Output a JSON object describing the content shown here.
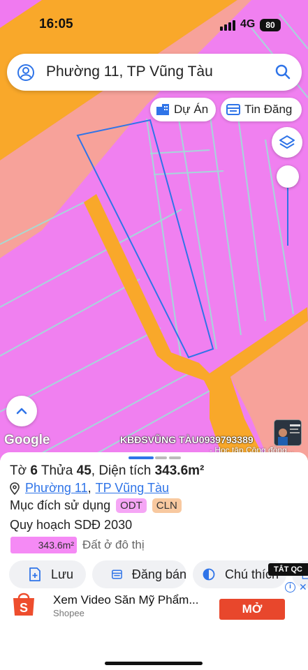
{
  "status_bar": {
    "time": "16:05",
    "network": "4G",
    "battery": "80"
  },
  "search": {
    "text": "Phường 11, TP Vũng Tàu"
  },
  "chips": {
    "du_an": "Dự Án",
    "tin_dang": "Tin Đăng"
  },
  "map": {
    "attribution": "Google",
    "watermark": "KBĐSVŨNG TÀU0939793389",
    "watermark_sub": "- Học tập Cộng đồng..."
  },
  "parcel": {
    "to_label": "Tờ",
    "to_value": "6",
    "thua_label": "Thửa",
    "thua_value": "45",
    "area_label": "Diện tích",
    "area_value": "343.6m²",
    "ward": "Phường 11",
    "city": "TP Vũng Tàu",
    "use_label": "Mục đích sử dụng",
    "use_codes": [
      "ODT",
      "CLN"
    ],
    "plan_label": "Quy hoạch SDĐ 2030",
    "plan_area": "343.6m²",
    "plan_desc": "Đất ở đô thị"
  },
  "actions": {
    "save": "Lưu",
    "post_sale": "Đăng bán",
    "legend": "Chú thích"
  },
  "ad": {
    "close_label": "TẮT QC",
    "title": "Xem Video Săn Mỹ Phẩm...",
    "brand": "Shopee",
    "cta": "MỞ",
    "info": "i",
    "x": "✕"
  },
  "colors": {
    "residential": "#f080f0",
    "road": "#f9a82a",
    "commercial": "#f7a29a",
    "parcel_border": "#2f74e8",
    "accent": "#2f74e8",
    "cta": "#e8472c"
  }
}
